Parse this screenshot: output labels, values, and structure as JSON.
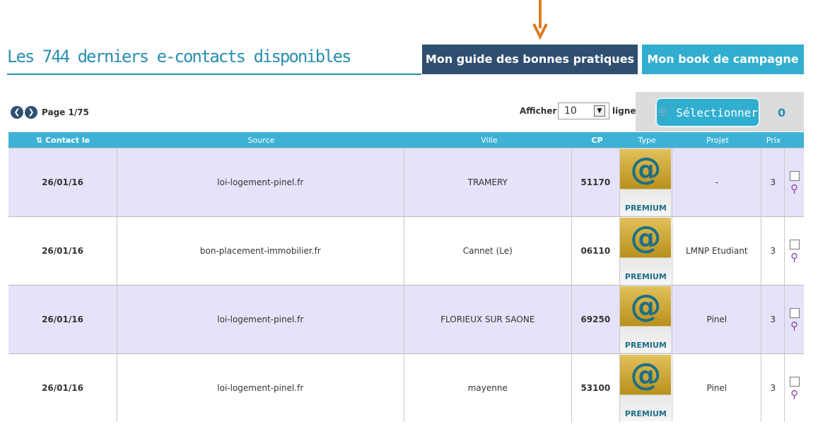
{
  "title": "Les 744 derniers e-contacts disponibles",
  "tabs": {
    "guide": "Mon guide des bonnes pratiques",
    "book": "Mon book de campagne"
  },
  "pager": {
    "page_label": "Page 1/75"
  },
  "display": {
    "afficher": "Afficher",
    "lines_value": "10",
    "lignes": "lignes"
  },
  "selection": {
    "button_label": "Sélectionner",
    "count": "0"
  },
  "table": {
    "headers": {
      "contact": "Contact le",
      "source": "Source",
      "ville": "Ville",
      "cp": "CP",
      "type": "Type",
      "projet": "Projet",
      "prix": "Prix"
    },
    "rows": [
      {
        "date": "26/01/16",
        "source": "loi-logement-pinel.fr",
        "ville": "TRAMERY",
        "cp": "51170",
        "type_badge": "PREMIUM",
        "type_symbol": "@",
        "projet": "-",
        "prix": "3"
      },
      {
        "date": "26/01/16",
        "source": "bon-placement-immobilier.fr",
        "ville": "Cannet (Le)",
        "cp": "06110",
        "type_badge": "PREMIUM",
        "type_symbol": "@",
        "projet": "LMNP Etudiant",
        "prix": "3"
      },
      {
        "date": "26/01/16",
        "source": "loi-logement-pinel.fr",
        "ville": "FLORIEUX SUR SAONE",
        "cp": "69250",
        "type_badge": "PREMIUM",
        "type_symbol": "@",
        "projet": "Pinel",
        "prix": "3"
      },
      {
        "date": "26/01/16",
        "source": "loi-logement-pinel.fr",
        "ville": "mayenne",
        "cp": "53100",
        "type_badge": "PREMIUM",
        "type_symbol": "@",
        "projet": "Pinel",
        "prix": "3"
      }
    ]
  },
  "colors": {
    "title": "#2a8fb0",
    "tab_guide": "#2f4f71",
    "tab_book": "#31aecf",
    "header": "#3eb2d6",
    "row_odd": "#e4e3f9",
    "arrow": "#e07a22"
  },
  "icons": {
    "prev": "chevron-left-icon",
    "next": "chevron-right-icon",
    "sort": "sort-icon",
    "cart": "cart-icon",
    "zoom": "zoom-icon",
    "arrow": "arrow-down-icon"
  }
}
